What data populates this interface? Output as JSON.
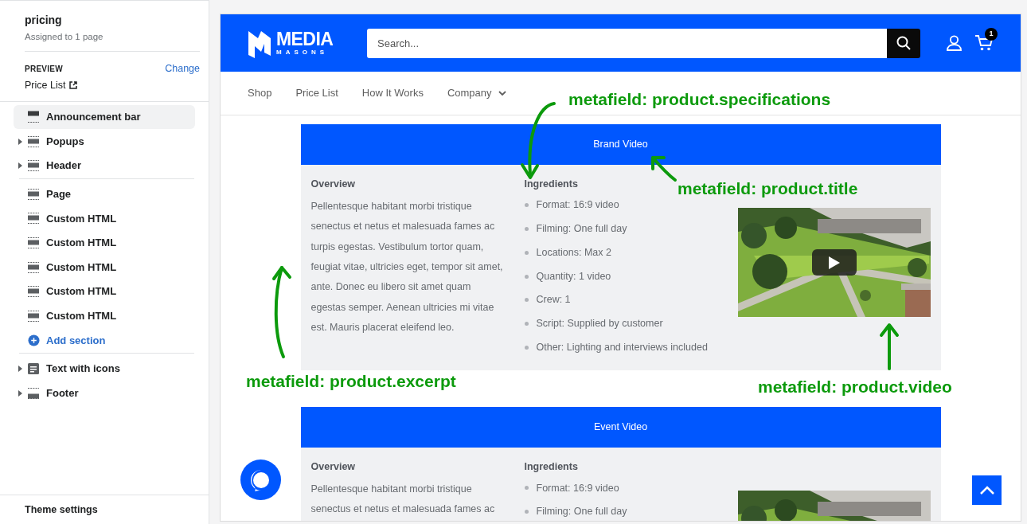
{
  "template": {
    "title": "pricing",
    "subtitle": "Assigned to 1 page"
  },
  "preview": {
    "label": "PREVIEW",
    "change": "Change",
    "page": "Price List"
  },
  "section_groups": [
    {
      "items": [
        {
          "kind": "topbar",
          "label": "Announcement bar",
          "expandable": false,
          "selected": true
        },
        {
          "kind": "section",
          "label": "Popups",
          "expandable": true,
          "selected": false
        },
        {
          "kind": "section",
          "label": "Header",
          "expandable": true,
          "selected": false
        }
      ]
    },
    {
      "items": [
        {
          "kind": "section",
          "label": "Page",
          "expandable": false,
          "selected": false
        },
        {
          "kind": "section",
          "label": "Custom HTML",
          "expandable": false,
          "selected": false
        },
        {
          "kind": "section",
          "label": "Custom HTML",
          "expandable": false,
          "selected": false
        },
        {
          "kind": "section",
          "label": "Custom HTML",
          "expandable": false,
          "selected": false
        },
        {
          "kind": "section",
          "label": "Custom HTML",
          "expandable": false,
          "selected": false
        },
        {
          "kind": "section",
          "label": "Custom HTML",
          "expandable": false,
          "selected": false
        },
        {
          "kind": "add",
          "label": "Add section"
        }
      ]
    },
    {
      "items": [
        {
          "kind": "textblock",
          "label": "Text with icons",
          "expandable": true,
          "selected": false
        },
        {
          "kind": "footer",
          "label": "Footer",
          "expandable": true,
          "selected": false
        }
      ]
    }
  ],
  "theme_settings": "Theme settings",
  "store": {
    "logo_top": "MEDIA",
    "logo_bottom": "MASONS",
    "search_placeholder": "Search...",
    "cart_count": "1",
    "nav": [
      {
        "label": "Shop",
        "dropdown": false
      },
      {
        "label": "Price List",
        "dropdown": false
      },
      {
        "label": "How It Works",
        "dropdown": false
      },
      {
        "label": "Company",
        "dropdown": true
      }
    ]
  },
  "products": [
    {
      "title": "Brand Video",
      "overview_heading": "Overview",
      "overview": "Pellentesque habitant morbi tristique senectus et netus et malesuada fames ac turpis egestas. Vestibulum tortor quam, feugiat vitae, ultricies eget, tempor sit amet, ante. Donec eu libero sit amet quam egestas semper. Aenean ultricies mi vitae est. Mauris placerat eleifend leo.",
      "ingredients_heading": "Ingredients",
      "ingredients": [
        "Format: 16:9 video",
        "Filming: One full day",
        "Locations: Max 2",
        "Quantity: 1 video",
        "Crew: 1",
        "Script: Supplied by customer",
        "Other: Lighting and interviews included"
      ],
      "play_button": true
    },
    {
      "title": "Event Video",
      "overview_heading": "Overview",
      "overview": "Pellentesque habitant morbi tristique senectus et netus et malesuada fames ac",
      "ingredients_heading": "Ingredients",
      "ingredients": [
        "Format: 16:9 video",
        "Filming: One full day"
      ]
    }
  ],
  "annotations": [
    {
      "text": "metafield: product.specifications"
    },
    {
      "text": "metafield: product.title"
    },
    {
      "text": "metafield: product.excerpt"
    },
    {
      "text": "metafield: product.video"
    }
  ]
}
